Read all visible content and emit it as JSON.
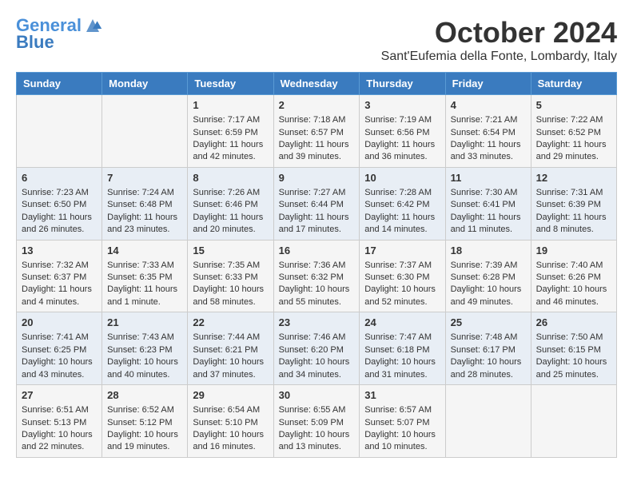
{
  "header": {
    "logo_line1": "General",
    "logo_line2": "Blue",
    "month": "October 2024",
    "location": "Sant'Eufemia della Fonte, Lombardy, Italy"
  },
  "days_of_week": [
    "Sunday",
    "Monday",
    "Tuesday",
    "Wednesday",
    "Thursday",
    "Friday",
    "Saturday"
  ],
  "weeks": [
    [
      {
        "day": "",
        "sunrise": "",
        "sunset": "",
        "daylight": ""
      },
      {
        "day": "",
        "sunrise": "",
        "sunset": "",
        "daylight": ""
      },
      {
        "day": "1",
        "sunrise": "Sunrise: 7:17 AM",
        "sunset": "Sunset: 6:59 PM",
        "daylight": "Daylight: 11 hours and 42 minutes."
      },
      {
        "day": "2",
        "sunrise": "Sunrise: 7:18 AM",
        "sunset": "Sunset: 6:57 PM",
        "daylight": "Daylight: 11 hours and 39 minutes."
      },
      {
        "day": "3",
        "sunrise": "Sunrise: 7:19 AM",
        "sunset": "Sunset: 6:56 PM",
        "daylight": "Daylight: 11 hours and 36 minutes."
      },
      {
        "day": "4",
        "sunrise": "Sunrise: 7:21 AM",
        "sunset": "Sunset: 6:54 PM",
        "daylight": "Daylight: 11 hours and 33 minutes."
      },
      {
        "day": "5",
        "sunrise": "Sunrise: 7:22 AM",
        "sunset": "Sunset: 6:52 PM",
        "daylight": "Daylight: 11 hours and 29 minutes."
      }
    ],
    [
      {
        "day": "6",
        "sunrise": "Sunrise: 7:23 AM",
        "sunset": "Sunset: 6:50 PM",
        "daylight": "Daylight: 11 hours and 26 minutes."
      },
      {
        "day": "7",
        "sunrise": "Sunrise: 7:24 AM",
        "sunset": "Sunset: 6:48 PM",
        "daylight": "Daylight: 11 hours and 23 minutes."
      },
      {
        "day": "8",
        "sunrise": "Sunrise: 7:26 AM",
        "sunset": "Sunset: 6:46 PM",
        "daylight": "Daylight: 11 hours and 20 minutes."
      },
      {
        "day": "9",
        "sunrise": "Sunrise: 7:27 AM",
        "sunset": "Sunset: 6:44 PM",
        "daylight": "Daylight: 11 hours and 17 minutes."
      },
      {
        "day": "10",
        "sunrise": "Sunrise: 7:28 AM",
        "sunset": "Sunset: 6:42 PM",
        "daylight": "Daylight: 11 hours and 14 minutes."
      },
      {
        "day": "11",
        "sunrise": "Sunrise: 7:30 AM",
        "sunset": "Sunset: 6:41 PM",
        "daylight": "Daylight: 11 hours and 11 minutes."
      },
      {
        "day": "12",
        "sunrise": "Sunrise: 7:31 AM",
        "sunset": "Sunset: 6:39 PM",
        "daylight": "Daylight: 11 hours and 8 minutes."
      }
    ],
    [
      {
        "day": "13",
        "sunrise": "Sunrise: 7:32 AM",
        "sunset": "Sunset: 6:37 PM",
        "daylight": "Daylight: 11 hours and 4 minutes."
      },
      {
        "day": "14",
        "sunrise": "Sunrise: 7:33 AM",
        "sunset": "Sunset: 6:35 PM",
        "daylight": "Daylight: 11 hours and 1 minute."
      },
      {
        "day": "15",
        "sunrise": "Sunrise: 7:35 AM",
        "sunset": "Sunset: 6:33 PM",
        "daylight": "Daylight: 10 hours and 58 minutes."
      },
      {
        "day": "16",
        "sunrise": "Sunrise: 7:36 AM",
        "sunset": "Sunset: 6:32 PM",
        "daylight": "Daylight: 10 hours and 55 minutes."
      },
      {
        "day": "17",
        "sunrise": "Sunrise: 7:37 AM",
        "sunset": "Sunset: 6:30 PM",
        "daylight": "Daylight: 10 hours and 52 minutes."
      },
      {
        "day": "18",
        "sunrise": "Sunrise: 7:39 AM",
        "sunset": "Sunset: 6:28 PM",
        "daylight": "Daylight: 10 hours and 49 minutes."
      },
      {
        "day": "19",
        "sunrise": "Sunrise: 7:40 AM",
        "sunset": "Sunset: 6:26 PM",
        "daylight": "Daylight: 10 hours and 46 minutes."
      }
    ],
    [
      {
        "day": "20",
        "sunrise": "Sunrise: 7:41 AM",
        "sunset": "Sunset: 6:25 PM",
        "daylight": "Daylight: 10 hours and 43 minutes."
      },
      {
        "day": "21",
        "sunrise": "Sunrise: 7:43 AM",
        "sunset": "Sunset: 6:23 PM",
        "daylight": "Daylight: 10 hours and 40 minutes."
      },
      {
        "day": "22",
        "sunrise": "Sunrise: 7:44 AM",
        "sunset": "Sunset: 6:21 PM",
        "daylight": "Daylight: 10 hours and 37 minutes."
      },
      {
        "day": "23",
        "sunrise": "Sunrise: 7:46 AM",
        "sunset": "Sunset: 6:20 PM",
        "daylight": "Daylight: 10 hours and 34 minutes."
      },
      {
        "day": "24",
        "sunrise": "Sunrise: 7:47 AM",
        "sunset": "Sunset: 6:18 PM",
        "daylight": "Daylight: 10 hours and 31 minutes."
      },
      {
        "day": "25",
        "sunrise": "Sunrise: 7:48 AM",
        "sunset": "Sunset: 6:17 PM",
        "daylight": "Daylight: 10 hours and 28 minutes."
      },
      {
        "day": "26",
        "sunrise": "Sunrise: 7:50 AM",
        "sunset": "Sunset: 6:15 PM",
        "daylight": "Daylight: 10 hours and 25 minutes."
      }
    ],
    [
      {
        "day": "27",
        "sunrise": "Sunrise: 6:51 AM",
        "sunset": "Sunset: 5:13 PM",
        "daylight": "Daylight: 10 hours and 22 minutes."
      },
      {
        "day": "28",
        "sunrise": "Sunrise: 6:52 AM",
        "sunset": "Sunset: 5:12 PM",
        "daylight": "Daylight: 10 hours and 19 minutes."
      },
      {
        "day": "29",
        "sunrise": "Sunrise: 6:54 AM",
        "sunset": "Sunset: 5:10 PM",
        "daylight": "Daylight: 10 hours and 16 minutes."
      },
      {
        "day": "30",
        "sunrise": "Sunrise: 6:55 AM",
        "sunset": "Sunset: 5:09 PM",
        "daylight": "Daylight: 10 hours and 13 minutes."
      },
      {
        "day": "31",
        "sunrise": "Sunrise: 6:57 AM",
        "sunset": "Sunset: 5:07 PM",
        "daylight": "Daylight: 10 hours and 10 minutes."
      },
      {
        "day": "",
        "sunrise": "",
        "sunset": "",
        "daylight": ""
      },
      {
        "day": "",
        "sunrise": "",
        "sunset": "",
        "daylight": ""
      }
    ]
  ]
}
